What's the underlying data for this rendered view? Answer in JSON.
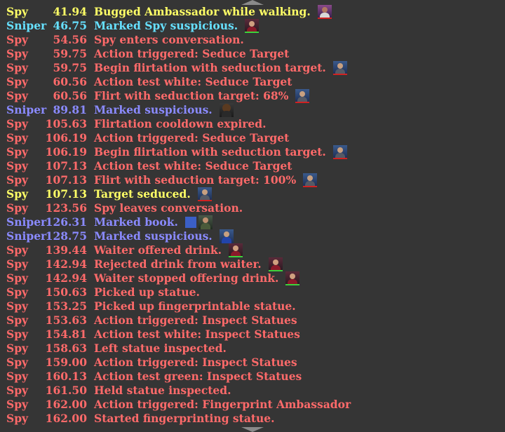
{
  "colors": {
    "spy_default": "#ff6a6a",
    "spy_highlight": "#ffff66",
    "sniper_cyan": "#66e0ff",
    "sniper_blue": "#8a8aff",
    "background": "#353535"
  },
  "rows": [
    {
      "role": "Spy",
      "time": "41.94",
      "event": "Bugged Ambassador while walking.",
      "color": "#ffff66",
      "icons": [
        "ambassador-portrait"
      ]
    },
    {
      "role": "Sniper",
      "time": "46.75",
      "event": "Marked Spy suspicious.",
      "color": "#66e0ff",
      "icons": [
        "lady-portrait"
      ]
    },
    {
      "role": "Spy",
      "time": "54.56",
      "event": "Spy enters conversation.",
      "color": "#ff6a6a",
      "icons": []
    },
    {
      "role": "Spy",
      "time": "59.75",
      "event": "Action triggered: Seduce Target",
      "color": "#ff6a6a",
      "icons": []
    },
    {
      "role": "Spy",
      "time": "59.75",
      "event": "Begin flirtation with seduction target.",
      "color": "#ff6a6a",
      "icons": [
        "target-portrait"
      ]
    },
    {
      "role": "Spy",
      "time": "60.56",
      "event": "Action test white: Seduce Target",
      "color": "#ff6a6a",
      "icons": []
    },
    {
      "role": "Spy",
      "time": "60.56",
      "event": "Flirt with seduction target: 68%",
      "color": "#ff6a6a",
      "icons": [
        "target-portrait"
      ]
    },
    {
      "role": "Sniper",
      "time": "89.81",
      "event": "Marked suspicious.",
      "color": "#8a8aff",
      "icons": [
        "afro-portrait"
      ]
    },
    {
      "role": "Spy",
      "time": "105.63",
      "event": "Flirtation cooldown expired.",
      "color": "#ff6a6a",
      "icons": []
    },
    {
      "role": "Spy",
      "time": "106.19",
      "event": "Action triggered: Seduce Target",
      "color": "#ff6a6a",
      "icons": []
    },
    {
      "role": "Spy",
      "time": "106.19",
      "event": "Begin flirtation with seduction target.",
      "color": "#ff6a6a",
      "icons": [
        "target-portrait"
      ]
    },
    {
      "role": "Spy",
      "time": "107.13",
      "event": "Action test white: Seduce Target",
      "color": "#ff6a6a",
      "icons": []
    },
    {
      "role": "Spy",
      "time": "107.13",
      "event": "Flirt with seduction target: 100%",
      "color": "#ff6a6a",
      "icons": [
        "target-portrait"
      ]
    },
    {
      "role": "Spy",
      "time": "107.13",
      "event": "Target seduced.",
      "color": "#ffff66",
      "icons": [
        "target-portrait"
      ]
    },
    {
      "role": "Spy",
      "time": "123.56",
      "event": "Spy leaves conversation.",
      "color": "#ff6a6a",
      "icons": []
    },
    {
      "role": "Sniper",
      "time": "126.31",
      "event": "Marked book.",
      "color": "#8a8aff",
      "icons": [
        "book-square",
        "military-portrait"
      ]
    },
    {
      "role": "Sniper",
      "time": "128.75",
      "event": "Marked suspicious.",
      "color": "#8a8aff",
      "icons": [
        "blue-suit-portrait"
      ]
    },
    {
      "role": "Spy",
      "time": "139.44",
      "event": "Waiter offered drink.",
      "color": "#ff6a6a",
      "icons": [
        "lady-portrait"
      ]
    },
    {
      "role": "Spy",
      "time": "142.94",
      "event": "Rejected drink from waiter.",
      "color": "#ff6a6a",
      "icons": [
        "lady-portrait"
      ]
    },
    {
      "role": "Spy",
      "time": "142.94",
      "event": "Waiter stopped offering drink.",
      "color": "#ff6a6a",
      "icons": [
        "lady-portrait"
      ]
    },
    {
      "role": "Spy",
      "time": "150.63",
      "event": "Picked up statue.",
      "color": "#ff6a6a",
      "icons": []
    },
    {
      "role": "Spy",
      "time": "153.25",
      "event": "Picked up fingerprintable statue.",
      "color": "#ff6a6a",
      "icons": []
    },
    {
      "role": "Spy",
      "time": "153.63",
      "event": "Action triggered: Inspect Statues",
      "color": "#ff6a6a",
      "icons": []
    },
    {
      "role": "Spy",
      "time": "154.81",
      "event": "Action test white: Inspect Statues",
      "color": "#ff6a6a",
      "icons": []
    },
    {
      "role": "Spy",
      "time": "158.63",
      "event": "Left statue inspected.",
      "color": "#ff6a6a",
      "icons": []
    },
    {
      "role": "Spy",
      "time": "159.00",
      "event": "Action triggered: Inspect Statues",
      "color": "#ff6a6a",
      "icons": []
    },
    {
      "role": "Spy",
      "time": "160.13",
      "event": "Action test green: Inspect Statues",
      "color": "#ff6a6a",
      "icons": []
    },
    {
      "role": "Spy",
      "time": "161.50",
      "event": "Held statue inspected.",
      "color": "#ff6a6a",
      "icons": []
    },
    {
      "role": "Spy",
      "time": "162.00",
      "event": "Action triggered: Fingerprint Ambassador",
      "color": "#ff6a6a",
      "icons": []
    },
    {
      "role": "Spy",
      "time": "162.00",
      "event": "Started fingerprinting statue.",
      "color": "#ff6a6a",
      "icons": []
    }
  ]
}
